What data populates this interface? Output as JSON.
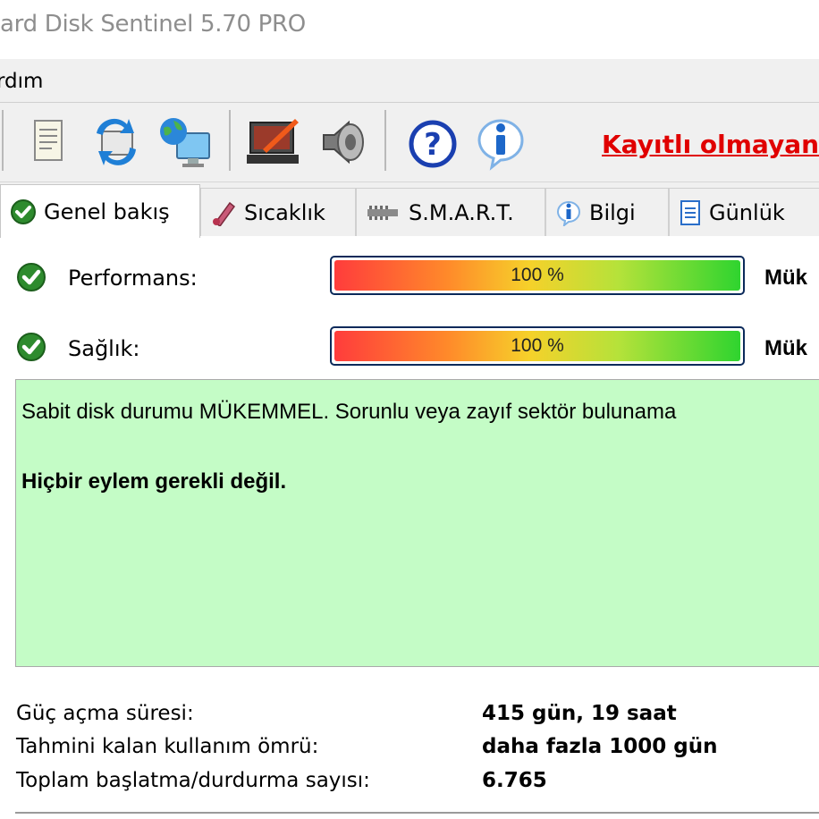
{
  "window": {
    "title": "ard Disk Sentinel 5.70 PRO"
  },
  "menu": {
    "items": [
      {
        "label": "rdım"
      }
    ]
  },
  "toolbar": {
    "buttons": [
      {
        "icon": "report-icon"
      },
      {
        "icon": "refresh-icon"
      },
      {
        "icon": "network-icon"
      },
      {
        "icon": "disk-test-icon"
      },
      {
        "icon": "sound-icon"
      },
      {
        "icon": "help-icon"
      },
      {
        "icon": "info-icon"
      }
    ],
    "registration_link": "Kayıtlı olmayan"
  },
  "tabs": [
    {
      "label": "Genel bakış",
      "icon": "ok-check-icon",
      "active": true
    },
    {
      "label": "Sıcaklık",
      "icon": "thermometer-icon"
    },
    {
      "label": "S.M.A.R.T.",
      "icon": "smart-icon"
    },
    {
      "label": "Bilgi",
      "icon": "info-icon"
    },
    {
      "label": "Günlük",
      "icon": "log-icon"
    }
  ],
  "metrics": {
    "performance": {
      "label": "Performans:",
      "value_text": "100 %",
      "percent": 100,
      "rating": "Mük"
    },
    "health": {
      "label": "Sağlık:",
      "value_text": "100 %",
      "percent": 100,
      "rating": "Mük"
    }
  },
  "status": {
    "message": "Sabit disk durumu MÜKEMMEL. Sorunlu veya zayıf sektör bulunama",
    "action": "Hiçbir eylem gerekli değil.",
    "background_color": "#c4fcc6"
  },
  "info": {
    "power_on_label": "Güç açma süresi:",
    "power_on_value": "415 gün, 19 saat",
    "lifetime_label": "Tahmini kalan kullanım ömrü:",
    "lifetime_value": "daha fazla 1000 gün",
    "starts_label": "Toplam başlatma/durdurma sayısı:",
    "starts_value": "6.765"
  },
  "colors": {
    "accent_red": "#e00000",
    "ok_green": "#2e8b2e",
    "panel_green": "#c4fcc6"
  }
}
